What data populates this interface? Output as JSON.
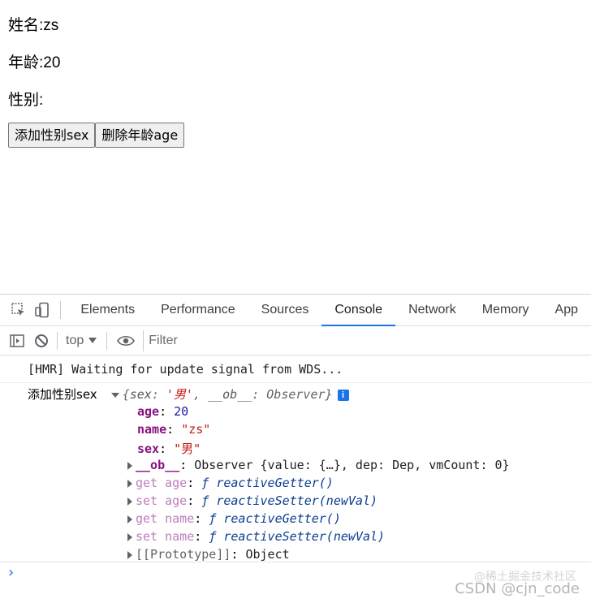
{
  "page": {
    "name_line": "姓名:zs",
    "age_line": "年龄:20",
    "sex_line": "性别:",
    "add_button": "添加性别sex",
    "delete_button": "删除年龄age"
  },
  "devtools": {
    "tabs": [
      "Elements",
      "Performance",
      "Sources",
      "Console",
      "Network",
      "Memory",
      "App"
    ],
    "active_tab": "Console",
    "context": "top",
    "filter_placeholder": "Filter"
  },
  "console": {
    "hmr_message": "[HMR] Waiting for update signal from WDS...",
    "log_label": "添加性别sex",
    "object_summary": {
      "open": "{",
      "k1": "sex",
      "v1": "'男'",
      "k2": "__ob__",
      "v2": "Observer",
      "close": "}"
    },
    "properties": [
      {
        "key": "age",
        "value": "20"
      },
      {
        "key": "name",
        "value": "\"zs\""
      },
      {
        "key": "sex",
        "value": "\"男\""
      }
    ],
    "ob_row": {
      "key": "__ob__",
      "value": "Observer {value: {…}, dep: Dep, vmCount: 0}"
    },
    "accessors": [
      {
        "prefix": "get age",
        "fn": "ƒ reactiveGetter()"
      },
      {
        "prefix": "set age",
        "fn": "ƒ reactiveSetter(newVal)"
      },
      {
        "prefix": "get name",
        "fn": "ƒ reactiveGetter()"
      },
      {
        "prefix": "set name",
        "fn": "ƒ reactiveSetter(newVal)"
      }
    ],
    "prototype_row": {
      "key": "[[Prototype]]",
      "value": "Object"
    },
    "info_badge": "i"
  },
  "watermark": {
    "top": "@稀土掘金技术社区",
    "bottom": "CSDN @cjn_code"
  }
}
